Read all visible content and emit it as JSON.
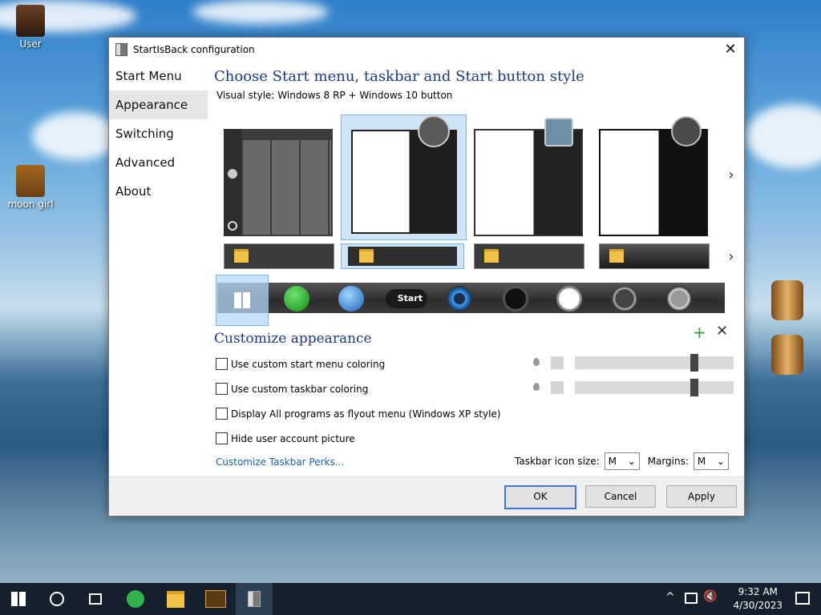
{
  "desktop": {
    "icons": [
      {
        "label": "User"
      },
      {
        "label": "moon girl"
      }
    ]
  },
  "window": {
    "title": "StartIsBack configuration",
    "close": "✕",
    "sidebar": [
      "Start Menu",
      "Appearance",
      "Switching",
      "Advanced",
      "About"
    ],
    "heading": "Choose Start menu, taskbar and Start button style",
    "visual_style": "Visual style:  Windows 8 RP + Windows 10 button",
    "next": "›",
    "customize_heading": "Customize appearance",
    "plus": "+",
    "remove": "✕",
    "options": [
      "Use custom start menu coloring",
      "Use custom taskbar coloring",
      "Display All programs as flyout menu (Windows XP style)",
      "Hide user account picture"
    ],
    "perks_link": "Customize Taskbar Perks...",
    "icon_size_label": "Taskbar icon size:",
    "icon_size_value": "M",
    "margins_label": "Margins:",
    "margins_value": "M",
    "buttons": {
      "ok": "OK",
      "cancel": "Cancel",
      "apply": "Apply"
    },
    "start_label": "Start"
  },
  "taskbar": {
    "time": "9:32 AM",
    "date": "4/30/2023"
  }
}
